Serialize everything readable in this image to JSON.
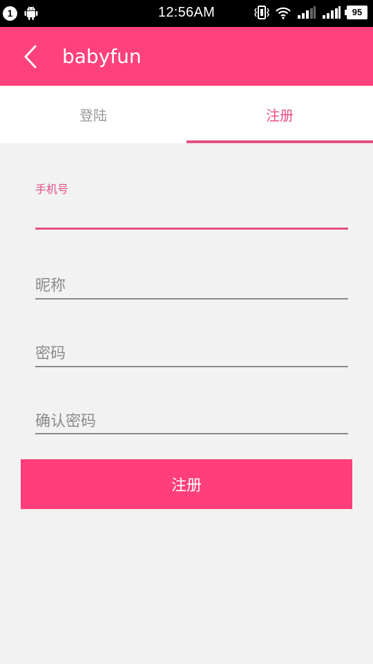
{
  "status_bar": {
    "notification_count": "1",
    "time": "12:56AM",
    "battery": "95",
    "icons": [
      "android-icon",
      "vibrate-icon",
      "wifi-icon",
      "signal-icon",
      "signal-icon"
    ]
  },
  "app_bar": {
    "title": "babyfun",
    "back_icon": "chevron-left-icon",
    "color": "#ff417d"
  },
  "tabs": [
    {
      "label": "登陆",
      "selected": false
    },
    {
      "label": "注册",
      "selected": true
    }
  ],
  "form": {
    "phone": {
      "label": "手机号",
      "value": ""
    },
    "nickname": {
      "placeholder": "昵称",
      "value": ""
    },
    "password": {
      "placeholder": "密码",
      "value": ""
    },
    "confirm_password": {
      "placeholder": "确认密码",
      "value": ""
    },
    "submit_label": "注册"
  },
  "colors": {
    "accent": "#e44e85",
    "button": "#ff3e7b",
    "background": "#f2f2f2"
  }
}
